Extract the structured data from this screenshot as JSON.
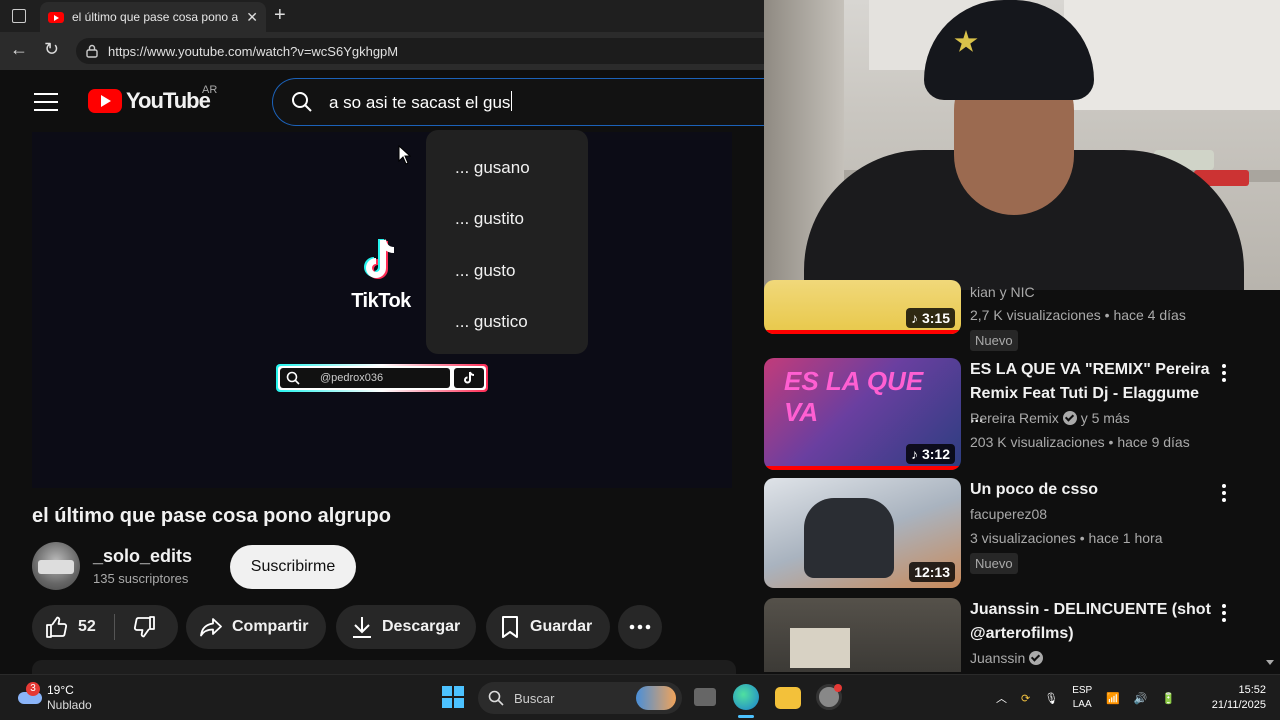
{
  "browser": {
    "tab_title": "el último que pase cosa pono algr",
    "url": "https://www.youtube.com/watch?v=wcS6YgkhgpM"
  },
  "youtube": {
    "logo_text": "YouTube",
    "region": "AR",
    "search_query": "a so asi te sacast el gus",
    "suggestions": [
      "... gusano",
      "... gustito",
      "... gusto",
      "... gustico"
    ]
  },
  "player": {
    "watermark_brand": "TikTok",
    "watermark_handle": "@pedrox036"
  },
  "video": {
    "title": "el último que pase cosa pono algrupo",
    "channel": "_solo_edits",
    "subscribers": "135 suscriptores",
    "subscribe_label": "Suscribirme",
    "likes": "52",
    "share_label": "Compartir",
    "download_label": "Descargar",
    "save_label": "Guardar"
  },
  "recommendations": [
    {
      "title": "",
      "channel": "kian y NIC",
      "views": "2,7 K visualizaciones",
      "age": "hace 4 días",
      "duration": "3:15",
      "badge": "Nuevo",
      "thumb_color": "#e8c84a"
    },
    {
      "title": "ES LA QUE VA \"REMIX\" Pereira Remix Feat Tuti Dj - Elaggume ...",
      "channel": "Pereira Remix",
      "channel_extra": "y 5 más",
      "views": "203 K visualizaciones",
      "age": "hace 9 días",
      "duration": "3:12",
      "thumb_color": "#6a3fa0"
    },
    {
      "title": "Un poco de csso",
      "channel": "facuperez08",
      "views": "3 visualizaciones",
      "age": "hace 1 hora",
      "duration": "12:13",
      "badge": "Nuevo",
      "thumb_color": "#b0b8c4"
    },
    {
      "title": "Juanssin - DELINCUENTE (shot @arterofilms)",
      "channel": "Juanssin",
      "thumb_color": "#3c3a36"
    }
  ],
  "taskbar": {
    "temperature": "19°C",
    "condition": "Nublado",
    "weather_badge": "3",
    "search_placeholder": "Buscar",
    "lang_top": "ESP",
    "lang_bottom": "LAA",
    "time": "15:52",
    "date": "21/11/2025"
  }
}
